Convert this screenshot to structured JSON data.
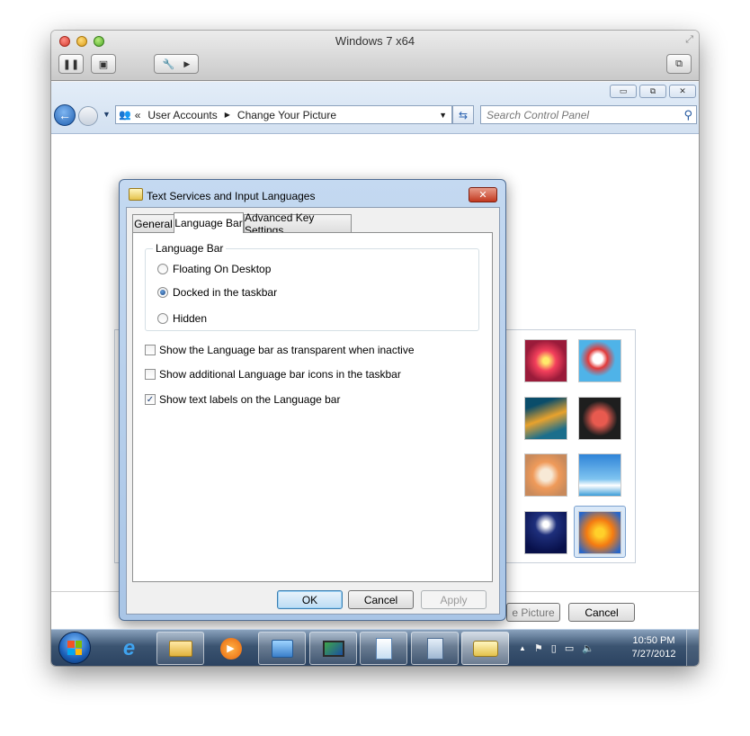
{
  "vm": {
    "title": "Windows 7 x64",
    "toolbar": {
      "pause_icon": "pause-icon",
      "snapshot_icon": "snapshot-icon",
      "settings_icon": "wrench-icon",
      "forward_icon": "play-arrow-icon",
      "window_icon": "window-icon"
    }
  },
  "explorer": {
    "breadcrumb": {
      "overflow": "«",
      "items": [
        "User Accounts",
        "Change Your Picture"
      ]
    },
    "search": {
      "placeholder": "Search Control Panel"
    }
  },
  "control_panel": {
    "change_picture_partial": "e Picture",
    "cancel_label": "Cancel"
  },
  "dialog": {
    "title": "Text Services and Input Languages",
    "tabs": [
      "General",
      "Language Bar",
      "Advanced Key Settings"
    ],
    "active_tab": "Language Bar",
    "group": {
      "title": "Language Bar",
      "options": [
        {
          "label": "Floating On Desktop",
          "selected": false
        },
        {
          "label": "Docked in the taskbar",
          "selected": true
        },
        {
          "label": "Hidden",
          "selected": false
        }
      ]
    },
    "checkboxes": [
      {
        "label": "Show the Language bar as transparent when inactive",
        "checked": false
      },
      {
        "label": "Show additional Language bar icons in the taskbar",
        "checked": false
      },
      {
        "label": "Show text labels on the Language bar",
        "checked": true
      }
    ],
    "buttons": {
      "ok": "OK",
      "cancel": "Cancel",
      "apply": "Apply"
    }
  },
  "taskbar": {
    "clock": {
      "time": "10:50 PM",
      "date": "7/27/2012"
    },
    "tray_arrow": "▲"
  },
  "colors": {
    "accent": "#3c7fb1",
    "taskbar": "#2b4260",
    "dialog_frame": "#a9c5e6"
  }
}
